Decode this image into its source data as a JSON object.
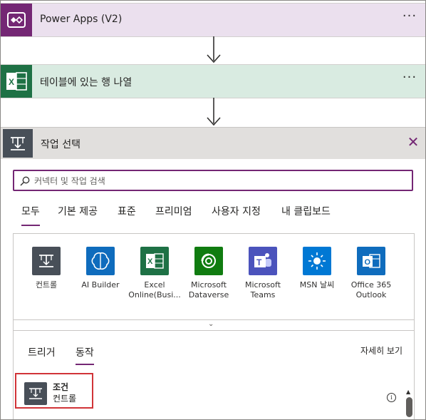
{
  "flow": {
    "trigger": {
      "title": "Power Apps (V2)",
      "more": "···"
    },
    "step": {
      "title": "테이블에 있는 행 나열",
      "more": "···"
    }
  },
  "panel": {
    "title": "작업 선택",
    "close": "✕",
    "search": {
      "placeholder": "커넥터 및 작업 검색",
      "value": ""
    },
    "tabs": [
      "모두",
      "기본 제공",
      "표준",
      "프리미엄",
      "사용자 지정",
      "내 클립보드"
    ],
    "active_tab": "모두",
    "connectors": [
      {
        "name": "컨트롤",
        "name2": "",
        "icon": "control-icon",
        "color": "#484f58"
      },
      {
        "name": "AI Builder",
        "name2": "",
        "icon": "ai-builder-icon",
        "color": "#0f6cbd"
      },
      {
        "name": "Excel",
        "name2": "Online(Busi...",
        "icon": "excel-icon",
        "color": "#1e7145"
      },
      {
        "name": "Microsoft",
        "name2": "Dataverse",
        "icon": "dataverse-icon",
        "color": "#107c10"
      },
      {
        "name": "Microsoft",
        "name2": "Teams",
        "icon": "teams-icon",
        "color": "#4b53bc"
      },
      {
        "name": "MSN 날씨",
        "name2": "",
        "icon": "weather-icon",
        "color": "#0078d4"
      },
      {
        "name": "Office 365",
        "name2": "Outlook",
        "icon": "outlook-icon",
        "color": "#0f6cbd"
      }
    ],
    "expand": "⌄",
    "subtabs": [
      "트리거",
      "동작"
    ],
    "active_subtab": "동작",
    "see_more": "자세히 보기",
    "action": {
      "name": "조건",
      "connector": "컨트롤"
    },
    "info": "i",
    "scroll_up": "▲"
  }
}
